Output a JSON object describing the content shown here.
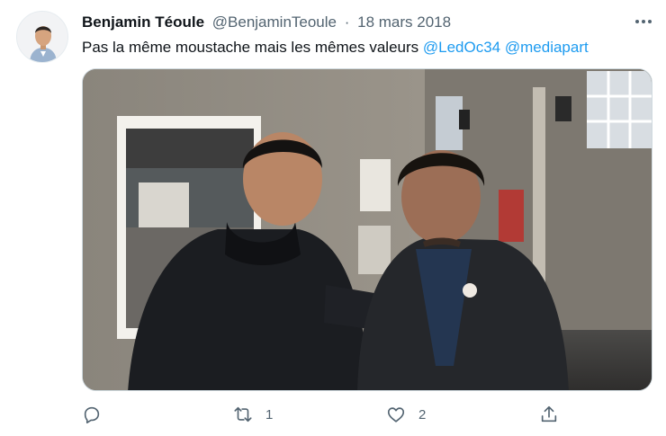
{
  "tweet": {
    "author_name": "Benjamin Téoule",
    "handle": "@BenjaminTeoule",
    "separator": "·",
    "date": "18 mars 2018",
    "text": "Pas la même moustache mais les mêmes valeurs",
    "mentions": [
      "@LedOc34",
      "@mediapart"
    ]
  },
  "actions": {
    "reply_count": "",
    "retweet_count": "1",
    "like_count": "2"
  },
  "icons": [
    "avatar",
    "more-icon",
    "reply-icon",
    "retweet-icon",
    "like-icon",
    "share-icon"
  ]
}
